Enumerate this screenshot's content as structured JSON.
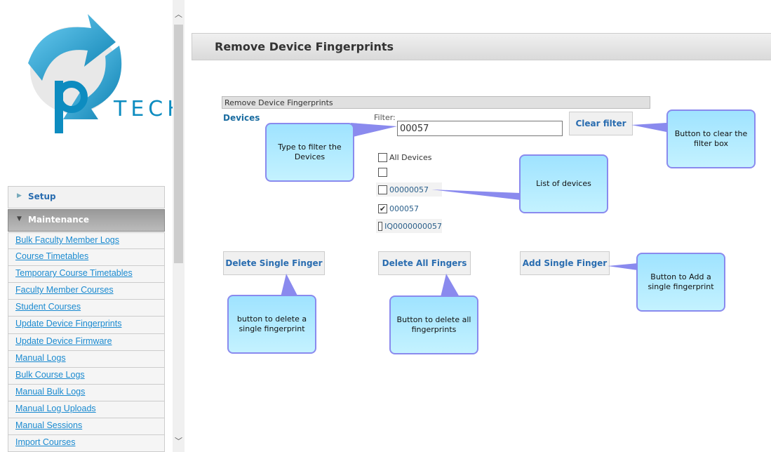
{
  "logo_text": "TECH",
  "sidebar": {
    "setup": "Setup",
    "maintenance": "Maintenance",
    "items": [
      "Bulk Faculty Member Logs",
      "Course Timetables",
      "Temporary Course Timetables",
      "Faculty Member Courses",
      "Student Courses",
      "Update Device Fingerprints",
      "Update Device Firmware",
      "Manual Logs",
      "Bulk Course Logs",
      "Manual Bulk Logs",
      "Manual Log Uploads",
      "Manual Sessions",
      "Import Courses"
    ]
  },
  "page": {
    "title": "Remove Device Fingerprints",
    "section_title": "Remove Device Fingerprints",
    "devices_label": "Devices",
    "filter_label": "Filter:",
    "filter_value": "00057",
    "clear_filter": "Clear filter",
    "devices": [
      {
        "label": "All Devices",
        "checked": false
      },
      {
        "label": "",
        "checked": false
      },
      {
        "label": "00000057",
        "checked": false
      },
      {
        "label": "000057",
        "checked": true
      },
      {
        "label": "IQ0000000057",
        "checked": false
      }
    ],
    "delete_single": "Delete Single Finger",
    "delete_all": "Delete All Fingers",
    "add_single": "Add Single Finger"
  },
  "callouts": {
    "filter": "Type to filter the Devices",
    "clear": "Button to clear the filter box",
    "list": "List of devices",
    "delete_single": "button to delete a single fingerprint",
    "delete_all": "Button to delete all fingerprints",
    "add_single": "Button to Add a single fingerprint"
  }
}
